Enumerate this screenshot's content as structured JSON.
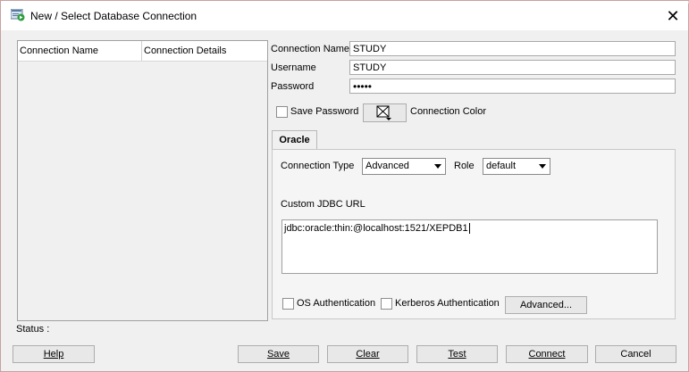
{
  "window": {
    "title": "New / Select Database Connection",
    "close_glyph": "✕"
  },
  "connections_list": {
    "columns": [
      "Connection Name",
      "Connection Details"
    ]
  },
  "form": {
    "connection_name_label": "Connection Name",
    "connection_name_value": "STUDY",
    "username_label": "Username",
    "username_value": "STUDY",
    "password_label": "Password",
    "password_value": "•••••",
    "save_password_label": "Save Password",
    "save_password_checked": false,
    "connection_color_label": "Connection Color"
  },
  "tab": {
    "label": "Oracle",
    "connection_type_label": "Connection Type",
    "connection_type_value": "Advanced",
    "role_label": "Role",
    "role_value": "default",
    "custom_url_label": "Custom JDBC URL",
    "custom_url_value": "jdbc:oracle:thin:@localhost:1521/XEPDB1",
    "os_auth_label": "OS Authentication",
    "os_auth_checked": false,
    "kerberos_auth_label": "Kerberos Authentication",
    "kerberos_auth_checked": false,
    "advanced_button": "Advanced..."
  },
  "status": {
    "label": "Status :"
  },
  "buttons": {
    "help": "Help",
    "save": "Save",
    "clear": "Clear",
    "test": "Test",
    "connect": "Connect",
    "cancel": "Cancel"
  },
  "icons": {
    "app": "database-connection-icon",
    "color": "color-picker-icon"
  }
}
